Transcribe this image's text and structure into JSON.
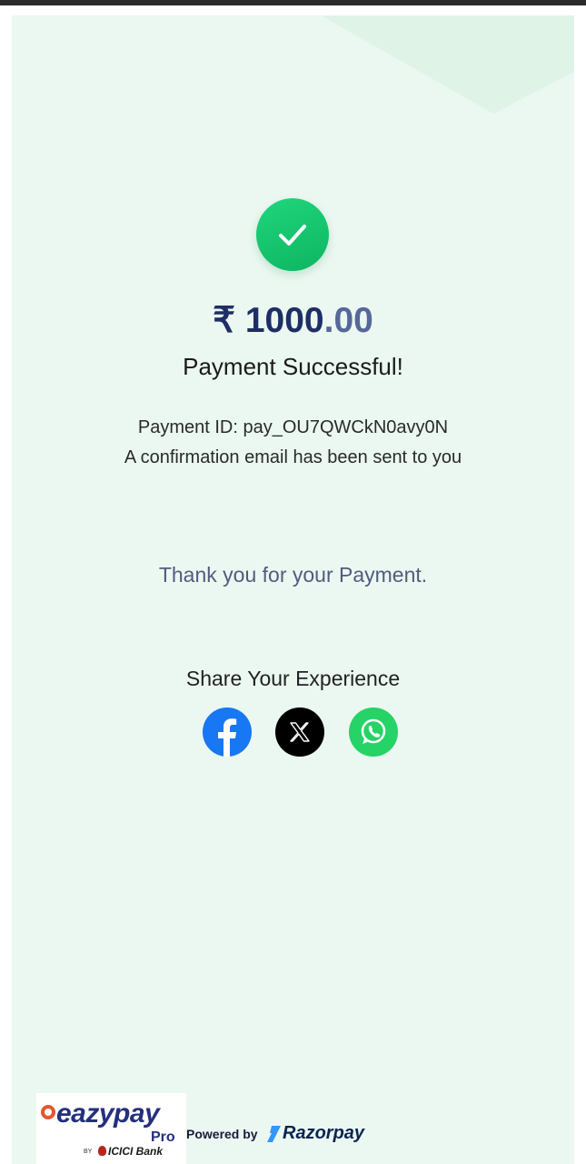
{
  "payment": {
    "currency_symbol": "₹",
    "amount_whole": "1000",
    "amount_decimal": ".00",
    "status": "Payment Successful!",
    "payment_id": "Payment ID: pay_OU7QWCkN0avy0N",
    "confirmation": "A confirmation email has been sent to you",
    "thanks": "Thank you for your Payment."
  },
  "share": {
    "title": "Share Your Experience",
    "icons": [
      "facebook-icon",
      "x-icon",
      "whatsapp-icon"
    ]
  },
  "footer": {
    "brand": "eazypay",
    "brand_suffix": "Pro",
    "by": "BY",
    "bank": "ICICI Bank",
    "powered_by": "Powered by",
    "gateway": "Razorpay"
  },
  "colors": {
    "background": "#ebf8f1",
    "success": "#16c06b",
    "amount": "#1e2e66",
    "facebook": "#1877f2",
    "whatsapp": "#25d366"
  }
}
